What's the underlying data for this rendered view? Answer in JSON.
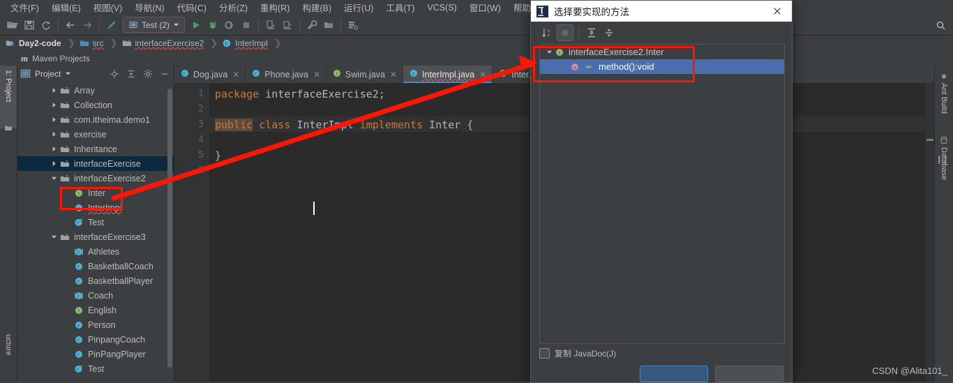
{
  "menubar": {
    "items": [
      {
        "label": "文件(F)",
        "key": "F"
      },
      {
        "label": "编辑(E)",
        "key": "E"
      },
      {
        "label": "视图(V)",
        "key": "V"
      },
      {
        "label": "导航(N)",
        "key": "N"
      },
      {
        "label": "代码(C)",
        "key": "C"
      },
      {
        "label": "分析(Z)",
        "key": "Z"
      },
      {
        "label": "重构(R)",
        "key": "R"
      },
      {
        "label": "构建(B)",
        "key": "B"
      },
      {
        "label": "运行(U)",
        "key": "U"
      },
      {
        "label": "工具(T)",
        "key": "T"
      },
      {
        "label": "VCS(S)",
        "key": "S"
      },
      {
        "label": "窗口(W)",
        "key": "W"
      },
      {
        "label": "帮助(H)",
        "key": "H"
      }
    ]
  },
  "toolbar": {
    "run_config": "Test (2)",
    "icons": [
      "open-folder-icon",
      "save-all-icon",
      "sync-icon",
      "back-arrow-icon",
      "forward-arrow-icon",
      "build-hammer-icon",
      "run-icon",
      "debug-icon",
      "run-coverage-icon",
      "stop-icon",
      "profile-icon",
      "attach-profiler-icon",
      "settings-wrench-icon",
      "project-structure-icon",
      "sdk-manager-icon"
    ],
    "search_icon": "search-icon"
  },
  "breadcrumb": {
    "items": [
      {
        "label": "Day2-code",
        "icon": "module-icon",
        "error": false
      },
      {
        "label": "src",
        "icon": "source-folder-icon",
        "error": true
      },
      {
        "label": "interfaceExercise2",
        "icon": "package-icon",
        "error": true
      },
      {
        "label": "InterImpl",
        "icon": "class-icon",
        "error": true
      }
    ]
  },
  "maven_row": {
    "label": "Maven Projects",
    "icon": "maven-icon"
  },
  "left_strip": {
    "tabs": [
      {
        "label": "1: Project",
        "icon": "project-icon",
        "selected": true
      },
      {
        "label": "ucture",
        "icon": "structure-icon",
        "selected": false
      }
    ]
  },
  "right_strip": {
    "tabs": [
      {
        "label": "Ant Build",
        "icon": "ant-icon"
      },
      {
        "label": "Database",
        "icon": "database-icon"
      }
    ]
  },
  "project_panel": {
    "title": "Project",
    "header_icons": [
      "locate-icon",
      "collapse-all-icon",
      "settings-gear-icon",
      "hide-icon"
    ],
    "tree": [
      {
        "label": "Array",
        "icon": "package-icon",
        "arrow": "collapsed",
        "indent": 2,
        "selected": false,
        "error": false
      },
      {
        "label": "Collection",
        "icon": "package-icon",
        "arrow": "collapsed",
        "indent": 2,
        "selected": false,
        "error": false
      },
      {
        "label": "com.itheima.demo1",
        "icon": "package-icon",
        "arrow": "collapsed",
        "indent": 2,
        "selected": false,
        "error": false
      },
      {
        "label": "exercise",
        "icon": "package-icon",
        "arrow": "collapsed",
        "indent": 2,
        "selected": false,
        "error": false
      },
      {
        "label": "Inheritance",
        "icon": "package-icon",
        "arrow": "collapsed",
        "indent": 2,
        "selected": false,
        "error": false
      },
      {
        "label": "interfaceExercise",
        "icon": "package-icon",
        "arrow": "collapsed",
        "indent": 2,
        "selected": true,
        "error": false
      },
      {
        "label": "interfaceExercise2",
        "icon": "package-icon",
        "arrow": "expanded",
        "indent": 2,
        "selected": false,
        "error": false
      },
      {
        "label": "Inter",
        "icon": "interface-icon",
        "arrow": "none",
        "indent": 3,
        "selected": false,
        "error": false
      },
      {
        "label": "InterImpl",
        "icon": "class-icon",
        "arrow": "none",
        "indent": 3,
        "selected": false,
        "error": true
      },
      {
        "label": "Test",
        "icon": "runnable-class-icon",
        "arrow": "none",
        "indent": 3,
        "selected": false,
        "error": false
      },
      {
        "label": "interfaceExercise3",
        "icon": "package-icon",
        "arrow": "expanded",
        "indent": 2,
        "selected": false,
        "error": false
      },
      {
        "label": "Athletes",
        "icon": "abstract-class-icon",
        "arrow": "none",
        "indent": 3,
        "selected": false,
        "error": false
      },
      {
        "label": "BasketballCoach",
        "icon": "class-icon",
        "arrow": "none",
        "indent": 3,
        "selected": false,
        "error": false
      },
      {
        "label": "BasketballPlayer",
        "icon": "class-icon",
        "arrow": "none",
        "indent": 3,
        "selected": false,
        "error": false
      },
      {
        "label": "Coach",
        "icon": "abstract-class-icon",
        "arrow": "none",
        "indent": 3,
        "selected": false,
        "error": false
      },
      {
        "label": "English",
        "icon": "interface-icon",
        "arrow": "none",
        "indent": 3,
        "selected": false,
        "error": false
      },
      {
        "label": "Person",
        "icon": "class-icon",
        "arrow": "none",
        "indent": 3,
        "selected": false,
        "error": false
      },
      {
        "label": "PinpangCoach",
        "icon": "class-icon",
        "arrow": "none",
        "indent": 3,
        "selected": false,
        "error": false
      },
      {
        "label": "PinPangPlayer",
        "icon": "class-icon",
        "arrow": "none",
        "indent": 3,
        "selected": false,
        "error": false
      },
      {
        "label": "Test",
        "icon": "runnable-class-icon",
        "arrow": "none",
        "indent": 3,
        "selected": false,
        "error": false
      }
    ]
  },
  "editor": {
    "tabs": [
      {
        "label": "Dog.java",
        "icon": "class-icon",
        "active": false,
        "error": false
      },
      {
        "label": "Phone.java",
        "icon": "class-icon",
        "active": false,
        "error": false
      },
      {
        "label": "Swim.java",
        "icon": "interface-icon",
        "active": false,
        "error": false
      },
      {
        "label": "InterImpl.java",
        "icon": "class-icon",
        "active": true,
        "error": true
      },
      {
        "label": "Inter.ja",
        "icon": "interface-icon",
        "active": false,
        "error": false
      }
    ],
    "line_numbers": [
      "1",
      "2",
      "3",
      "4",
      "5",
      "6"
    ],
    "code_lines": [
      {
        "n": 1,
        "tokens": [
          {
            "t": "package",
            "c": "kw"
          },
          {
            "t": " interfaceExercise2;",
            "c": "pl"
          }
        ]
      },
      {
        "n": 2,
        "tokens": []
      },
      {
        "n": 3,
        "tokens": [
          {
            "t": "public",
            "c": "kw-hl"
          },
          {
            "t": " ",
            "c": "pl"
          },
          {
            "t": "class",
            "c": "kw"
          },
          {
            "t": " InterImpl ",
            "c": "cls"
          },
          {
            "t": "implements",
            "c": "kw"
          },
          {
            "t": " Inter {",
            "c": "cls"
          }
        ]
      },
      {
        "n": 4,
        "tokens": []
      },
      {
        "n": 5,
        "tokens": [
          {
            "t": "}",
            "c": "pl"
          }
        ]
      },
      {
        "n": 6,
        "tokens": []
      }
    ]
  },
  "dialog": {
    "title": "选择要实现的方法",
    "title_icon": "intellij-idea-icon",
    "close_icon": "close-icon",
    "toolbar_icons": [
      {
        "name": "sort-alphabetically-icon",
        "on": false
      },
      {
        "name": "show-inherited-toggle-icon",
        "on": true
      },
      {
        "name": "expand-all-icon",
        "on": false
      },
      {
        "name": "collapse-all-icon",
        "on": false
      }
    ],
    "tree": [
      {
        "label": "interfaceExercise2.Inter",
        "icon": "interface-icon",
        "arrow": "expanded",
        "indent": 0,
        "selected": false
      },
      {
        "label": "method():void",
        "icon": "method-icon",
        "arrow": "none",
        "indent": 1,
        "selected": true,
        "extra_icon": "visibility-icon"
      }
    ],
    "copy_javadoc_label": "复制 JavaDoc(J)",
    "copy_javadoc_checked": false,
    "buttons": [
      {
        "label": "",
        "style": "primary"
      },
      {
        "label": "",
        "style": "secondary"
      }
    ]
  },
  "watermark": "CSDN @Alita101_",
  "colors": {
    "accent_blue": "#4b6eaf",
    "annotation_red": "#fb1708",
    "selection_navy": "#0d293e",
    "editor_bg": "#2b2b2b",
    "panel_bg": "#3c3f41"
  }
}
